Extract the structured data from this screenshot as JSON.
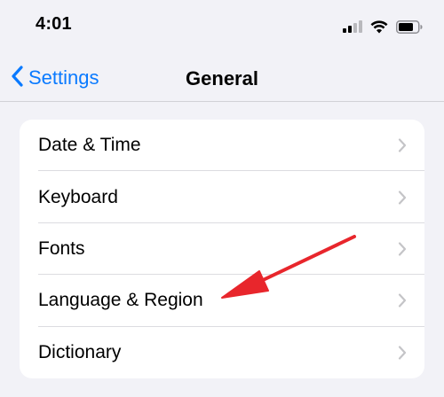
{
  "status_bar": {
    "time": "4:01"
  },
  "nav": {
    "back_label": "Settings",
    "title": "General"
  },
  "list": {
    "items": [
      {
        "label": "Date & Time"
      },
      {
        "label": "Keyboard"
      },
      {
        "label": "Fonts"
      },
      {
        "label": "Language & Region"
      },
      {
        "label": "Dictionary"
      }
    ]
  },
  "icons": {
    "back": "chevron-left-icon",
    "row": "chevron-right-icon",
    "signal": "cellular-signal-icon",
    "wifi": "wifi-icon",
    "battery": "battery-icon"
  },
  "colors": {
    "accent": "#0a7aff",
    "background": "#f2f2f7",
    "card": "#ffffff",
    "annotation_arrow": "#e8262c"
  }
}
